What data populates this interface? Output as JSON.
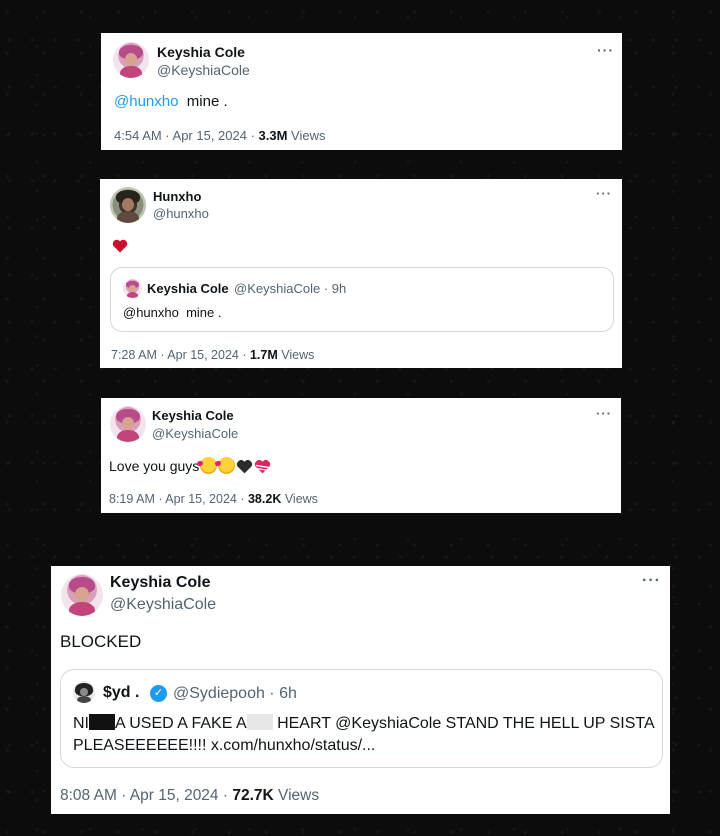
{
  "tweets": [
    {
      "name": "Keyshia Cole",
      "handle": "@KeyshiaCole",
      "more": "···",
      "mention": "@hunxho",
      "text": "mine .",
      "time": "4:54 AM · Apr 15, 2024 · ",
      "views": "3.3M",
      "views_label": " Views"
    },
    {
      "name": "Hunxho",
      "handle": "@hunxho",
      "more": "···",
      "heart_icon": "red-heart-icon",
      "quote": {
        "name": "Keyshia Cole",
        "handle_time": "@KeyshiaCole · 9h",
        "text": "@hunxho  mine ."
      },
      "time": "7:28 AM · Apr 15, 2024 · ",
      "views": "1.7M",
      "views_label": " Views"
    },
    {
      "name": "Keyshia Cole",
      "handle": "@KeyshiaCole",
      "more": "···",
      "text": "Love you guys",
      "emojis": [
        "smiling-face-with-hearts-icon",
        "smiling-face-with-hearts-icon",
        "black-heart-icon",
        "heart-with-ribbon-icon"
      ],
      "time": "8:19 AM · Apr 15, 2024 · ",
      "views": "38.2K",
      "views_label": " Views"
    },
    {
      "name": "Keyshia Cole",
      "handle": "@KeyshiaCole",
      "more": "···",
      "text": "BLOCKED",
      "quote": {
        "name": "$yd .",
        "handle_time": "@Sydiepooh · 6h",
        "line1_a": "NI",
        "line1_b": "A USED A FAKE A",
        "line1_c": " HEART @KeyshiaCole STAND THE HELL UP SISTA",
        "line2": "PLEASEEEEEE!!!! x.com/hunxho/status/..."
      },
      "time": "8:08 AM · Apr 15, 2024 · ",
      "views": "72.7K",
      "views_label": " Views"
    }
  ],
  "colors": {
    "link": "#1d9bf0",
    "muted": "#536471",
    "text": "#0f1419",
    "heart": "#c8102e"
  }
}
